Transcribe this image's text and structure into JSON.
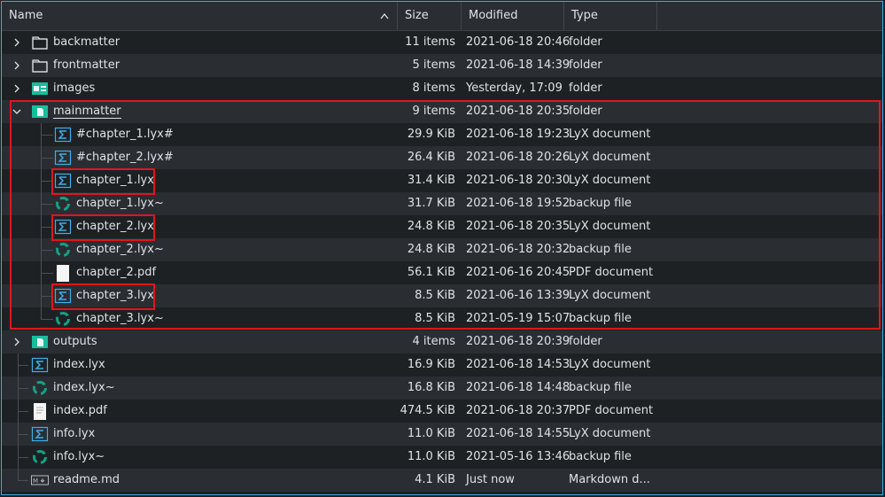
{
  "header": {
    "name": "Name",
    "size": "Size",
    "modified": "Modified",
    "type": "Type"
  },
  "rows": [
    {
      "name": "backmatter",
      "size": "11 items",
      "modified": "2021-06-18 20:46",
      "type": "folder",
      "icon": "folder-icon",
      "level": 0,
      "expand": "collapsed"
    },
    {
      "name": "frontmatter",
      "size": "5 items",
      "modified": "2021-06-18 14:39",
      "type": "folder",
      "icon": "folder-icon",
      "level": 0,
      "expand": "collapsed"
    },
    {
      "name": "images",
      "size": "8 items",
      "modified": "Yesterday, 17:09",
      "type": "folder",
      "icon": "image-folder-icon",
      "level": 0,
      "expand": "collapsed"
    },
    {
      "name": "mainmatter",
      "size": "9 items",
      "modified": "2021-06-18 20:35",
      "type": "folder",
      "icon": "document-folder-icon",
      "level": 0,
      "expand": "expanded"
    },
    {
      "name": "#chapter_1.lyx#",
      "size": "29.9 KiB",
      "modified": "2021-06-18 19:23",
      "type": "LyX document",
      "icon": "lyx-icon",
      "level": 1
    },
    {
      "name": "#chapter_2.lyx#",
      "size": "26.4 KiB",
      "modified": "2021-06-18 20:26",
      "type": "LyX document",
      "icon": "lyx-icon",
      "level": 1
    },
    {
      "name": "chapter_1.lyx",
      "size": "31.4 KiB",
      "modified": "2021-06-18 20:30",
      "type": "LyX document",
      "icon": "lyx-icon",
      "level": 1
    },
    {
      "name": "chapter_1.lyx~",
      "size": "31.7 KiB",
      "modified": "2021-06-18 19:52",
      "type": "backup file",
      "icon": "recycle-icon",
      "level": 1
    },
    {
      "name": "chapter_2.lyx",
      "size": "24.8 KiB",
      "modified": "2021-06-18 20:35",
      "type": "LyX document",
      "icon": "lyx-icon",
      "level": 1
    },
    {
      "name": "chapter_2.lyx~",
      "size": "24.8 KiB",
      "modified": "2021-06-18 20:32",
      "type": "backup file",
      "icon": "recycle-icon",
      "level": 1
    },
    {
      "name": "chapter_2.pdf",
      "size": "56.1 KiB",
      "modified": "2021-06-16 20:45",
      "type": "PDF document",
      "icon": "pdf-icon",
      "level": 1
    },
    {
      "name": "chapter_3.lyx",
      "size": "8.5 KiB",
      "modified": "2021-06-16 13:39",
      "type": "LyX document",
      "icon": "lyx-icon",
      "level": 1
    },
    {
      "name": "chapter_3.lyx~",
      "size": "8.5 KiB",
      "modified": "2021-05-19 15:07",
      "type": "backup file",
      "icon": "recycle-icon",
      "level": 1
    },
    {
      "name": "outputs",
      "size": "4 items",
      "modified": "2021-06-18 20:39",
      "type": "folder",
      "icon": "document-folder-icon",
      "level": 0,
      "expand": "collapsed"
    },
    {
      "name": "index.lyx",
      "size": "16.9 KiB",
      "modified": "2021-06-18 14:53",
      "type": "LyX document",
      "icon": "lyx-icon",
      "level": 0
    },
    {
      "name": "index.lyx~",
      "size": "16.8 KiB",
      "modified": "2021-06-18 14:48",
      "type": "backup file",
      "icon": "recycle-icon",
      "level": 0
    },
    {
      "name": "index.pdf",
      "size": "474.5 KiB",
      "modified": "2021-06-18 20:37",
      "type": "PDF document",
      "icon": "pdf-thumb-icon",
      "level": 0
    },
    {
      "name": "info.lyx",
      "size": "11.0 KiB",
      "modified": "2021-06-18 14:55",
      "type": "LyX document",
      "icon": "lyx-icon",
      "level": 0
    },
    {
      "name": "info.lyx~",
      "size": "11.0 KiB",
      "modified": "2021-05-16 13:46",
      "type": "backup file",
      "icon": "recycle-icon",
      "level": 0
    },
    {
      "name": "readme.md",
      "size": "4.1 KiB",
      "modified": "Just now",
      "type": "Markdown d...",
      "icon": "markdown-icon",
      "level": 0
    }
  ],
  "colors": {
    "accent": "#3daee9",
    "highlight": "#e0161b",
    "folder_green": "#1abc9c",
    "lyx_blue": "#3daee9"
  }
}
